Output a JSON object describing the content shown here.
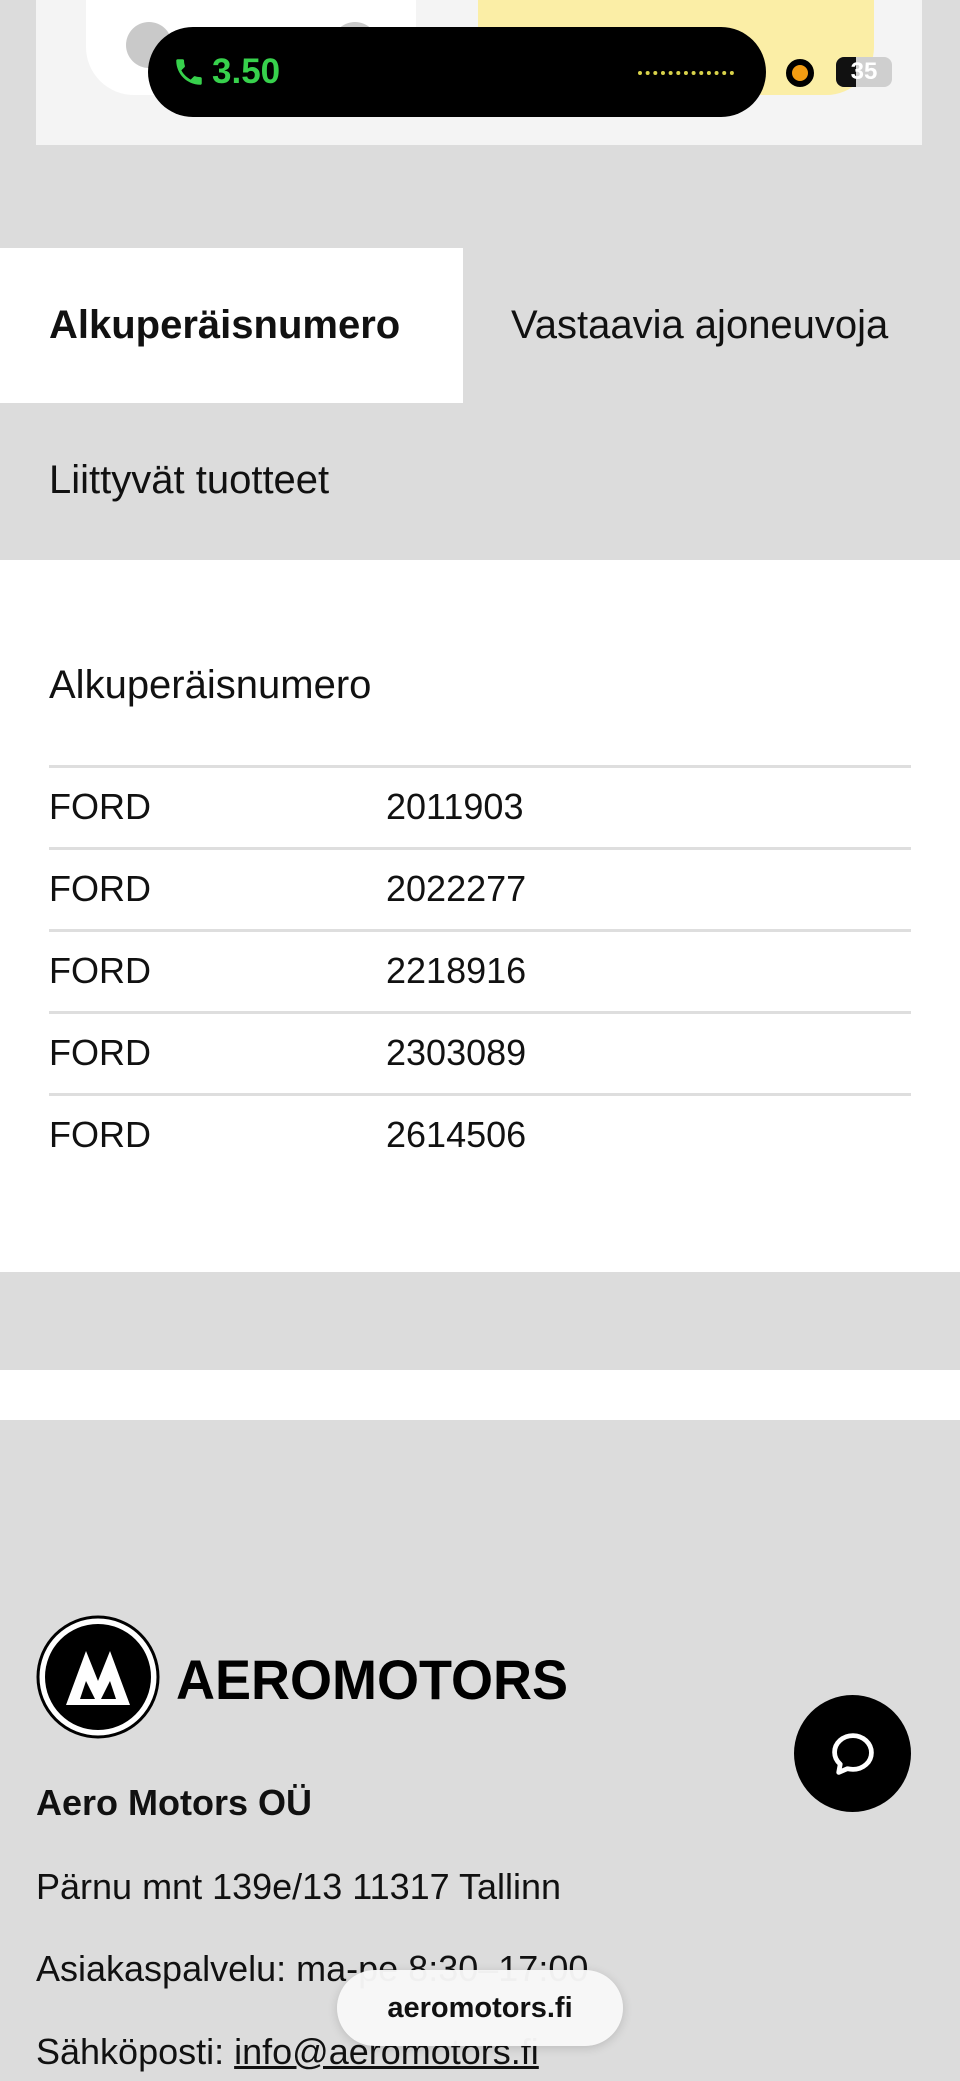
{
  "status_bar": {
    "call_time": "3.50",
    "battery_level": "35",
    "battery_fraction": 0.35,
    "call_color": "#37d14c",
    "record_color": "#f39c12",
    "icons": [
      "phone-icon",
      "waveform-icon",
      "recording-dot-icon",
      "battery-icon"
    ]
  },
  "top_controls": {
    "minus_icon": "minus-icon",
    "plus_icon": "plus-icon",
    "cart_color": "#fbeea6"
  },
  "tabs": [
    {
      "label": "Alkuperäisnumero",
      "active": true
    },
    {
      "label": "Vastaavia ajoneuvoja",
      "active": false
    },
    {
      "label": "Liittyvät tuotteet",
      "active": false
    }
  ],
  "panel": {
    "title": "Alkuperäisnumero",
    "rows": [
      {
        "brand": "FORD",
        "number": "2011903"
      },
      {
        "brand": "FORD",
        "number": "2022277"
      },
      {
        "brand": "FORD",
        "number": "2218916"
      },
      {
        "brand": "FORD",
        "number": "2303089"
      },
      {
        "brand": "FORD",
        "number": "2614506"
      }
    ]
  },
  "footer": {
    "logo_text": "AEROMOTORS",
    "company": "Aero Motors OÜ",
    "address": "Pärnu mnt 139e/13 11317 Tallinn",
    "hours": "Asiakaspalvelu: ma-pe 8:30–17:00",
    "email_label": "Sähköposti: ",
    "email": "info@aeromotors.fi"
  },
  "chat": {
    "icon": "chat-bubble-icon"
  },
  "browser": {
    "url": "aeromotors.fi"
  }
}
